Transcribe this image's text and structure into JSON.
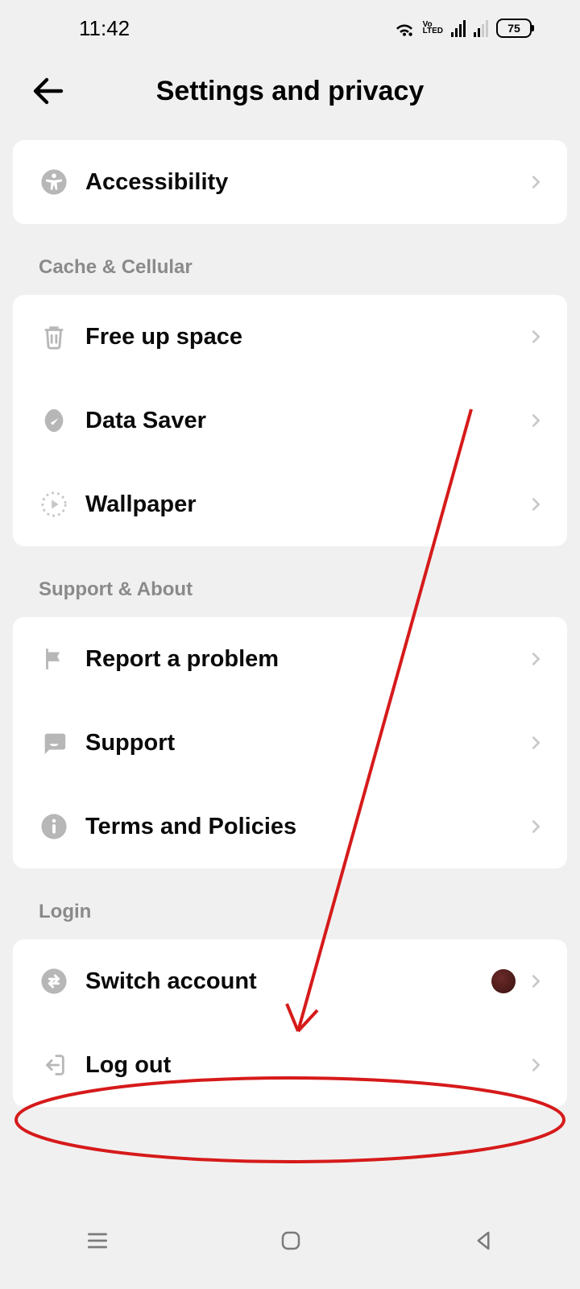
{
  "status": {
    "time": "11:42",
    "battery": "75"
  },
  "header": {
    "title": "Settings and privacy"
  },
  "sections": {
    "solo": {
      "accessibility": "Accessibility"
    },
    "cache": {
      "heading": "Cache & Cellular",
      "free_up": "Free up space",
      "data_saver": "Data Saver",
      "wallpaper": "Wallpaper"
    },
    "support": {
      "heading": "Support & About",
      "report": "Report a problem",
      "support": "Support",
      "terms": "Terms and Policies"
    },
    "login": {
      "heading": "Login",
      "switch": "Switch account",
      "logout": "Log out"
    }
  },
  "annotations": {
    "arrow_color": "#d61a1a",
    "circle_color": "#d61a1a"
  }
}
